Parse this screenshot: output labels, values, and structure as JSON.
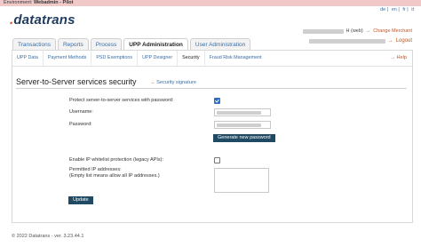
{
  "environment": {
    "prefix": "Environment: ",
    "name": "Webadmin - Pilot"
  },
  "logo": {
    "text": "datatrans",
    "dot": "."
  },
  "languages": [
    "de",
    "en",
    "fr",
    "it"
  ],
  "user": {
    "suffix": "H (web)",
    "change_merchant": "Change Merchant",
    "logout": "Logout"
  },
  "tabs": [
    {
      "label": "Transactions"
    },
    {
      "label": "Reports"
    },
    {
      "label": "Process"
    },
    {
      "label": "UPP Administration"
    },
    {
      "label": "User Administration"
    }
  ],
  "subnav": [
    {
      "label": "UPP Data"
    },
    {
      "label": "Payment Methods"
    },
    {
      "label": "PSD Exemptions"
    },
    {
      "label": "UPP Designer"
    },
    {
      "label": "Security"
    },
    {
      "label": "Fraud Risk Management"
    }
  ],
  "help": "Help",
  "section": {
    "title": "Server-to-Server services security",
    "signature_link": "Security signature"
  },
  "form": {
    "protect_label": "Protect server-to-server services with password:",
    "username_label": "Username:",
    "password_label": "Password:",
    "generate_button": "Generate new password",
    "ip_whitelist_label": "Enable IP whitelist protection (legacy APIs):",
    "permitted_ip_label": "Permitted IP addresses:",
    "permitted_ip_note": "(Empty list means allow all IP addresses.)",
    "update_button": "Update"
  },
  "footer": "© 2022 Datatrans - ver. 3.23.44.1"
}
